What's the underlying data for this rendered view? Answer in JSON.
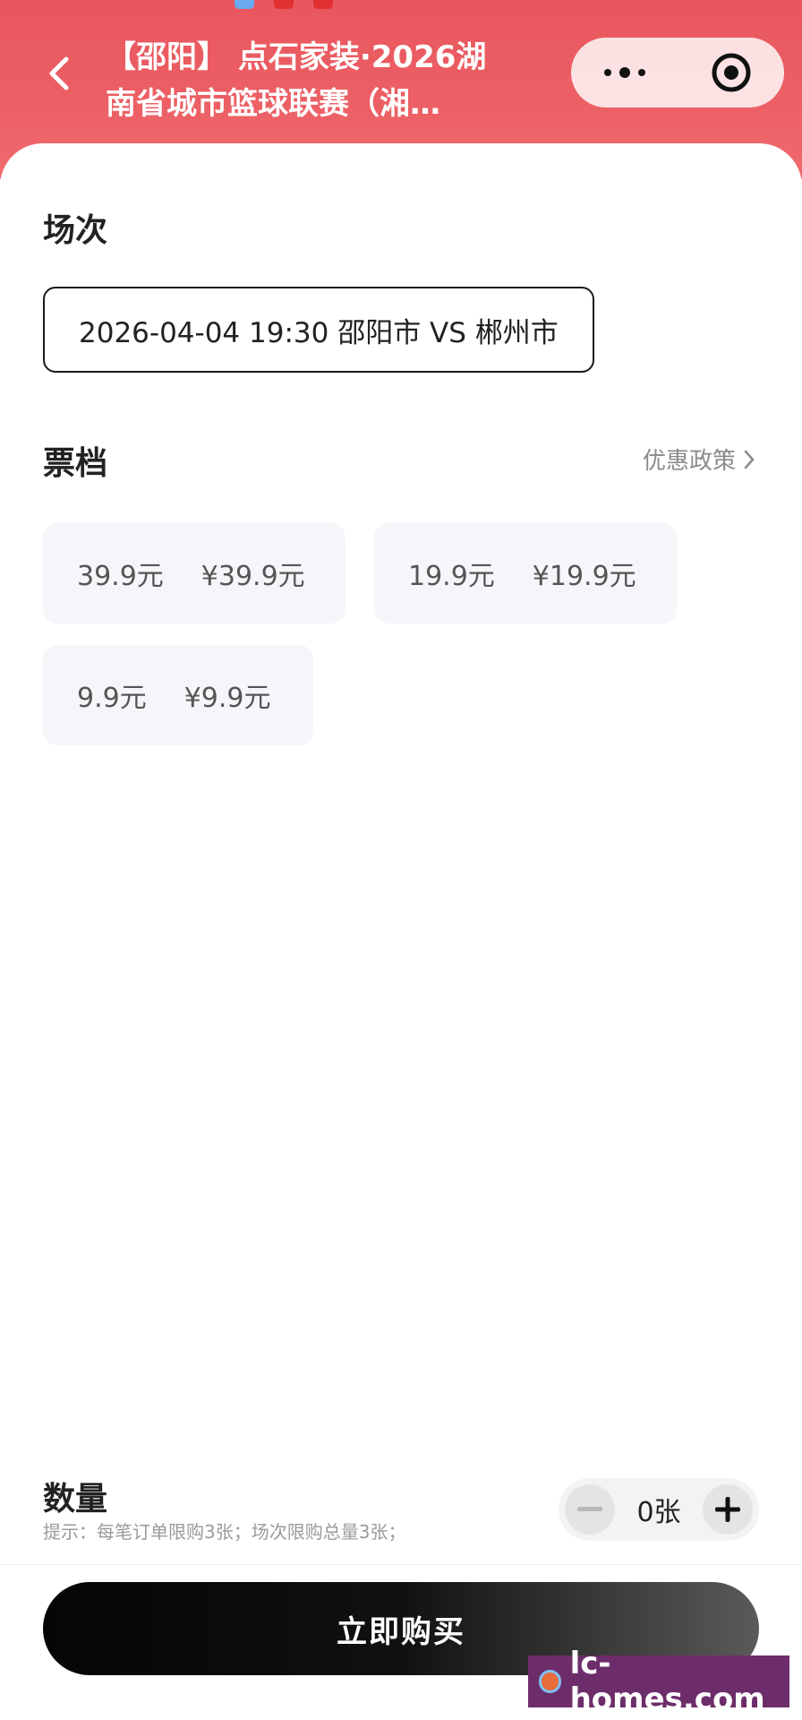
{
  "header": {
    "title_line1": "【邵阳】 点石家装·2026湖",
    "title_line2": "南省城市篮球联赛（湘…"
  },
  "session": {
    "section_title": "场次",
    "selected": "2026-04-04 19:30 邵阳市 VS 郴州市"
  },
  "tickets": {
    "section_title": "票档",
    "policy_link": "优惠政策",
    "items": [
      {
        "name": "39.9元",
        "price": "¥39.9元"
      },
      {
        "name": "19.9元",
        "price": "¥19.9元"
      },
      {
        "name": "9.9元",
        "price": "¥9.9元"
      }
    ]
  },
  "quantity": {
    "section_title": "数量",
    "hint": "提示：每笔订单限购3张；场次限购总量3张；",
    "value": "0张"
  },
  "buy_button": {
    "label": "立即购买"
  },
  "watermark": {
    "text": "lc-homes.com"
  },
  "colors": {
    "header_red": "#e8565e",
    "button_black": "#050505",
    "ticket_bg": "#f5f6f9"
  }
}
